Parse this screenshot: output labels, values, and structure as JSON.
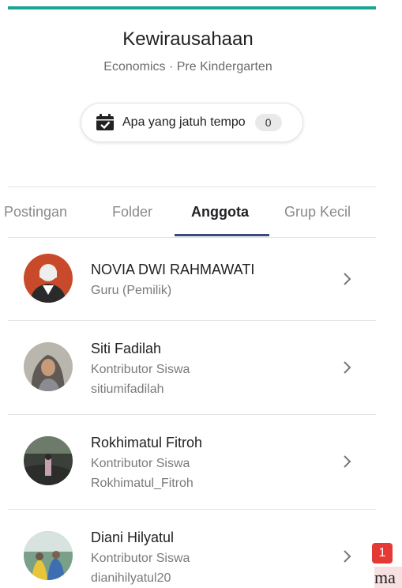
{
  "class": {
    "title": "Kewirausahaan",
    "subtitle": "Economics · Pre Kindergarten",
    "accent_color": "#1ba493"
  },
  "due": {
    "icon": "calendar-check-icon",
    "label": "Apa yang jatuh tempo",
    "count": "0"
  },
  "tabs": [
    {
      "label": "Postingan",
      "active": false
    },
    {
      "label": "Folder",
      "active": false
    },
    {
      "label": "Anggota",
      "active": true
    },
    {
      "label": "Grup Kecil",
      "active": false
    }
  ],
  "members": [
    {
      "name": "NOVIA DWI RAHMAWATI",
      "role": "Guru (Pemilik)",
      "username": ""
    },
    {
      "name": "Siti Fadilah",
      "role": "Kontributor Siswa",
      "username": "sitiumifadilah"
    },
    {
      "name": "Rokhimatul Fitroh",
      "role": "Kontributor Siswa",
      "username": "Rokhimatul_Fitroh"
    },
    {
      "name": "Diani Hilyatul",
      "role": "Kontributor Siswa",
      "username": "dianihilyatul20"
    }
  ],
  "annotation": {
    "badge": "1",
    "text": "ma"
  }
}
